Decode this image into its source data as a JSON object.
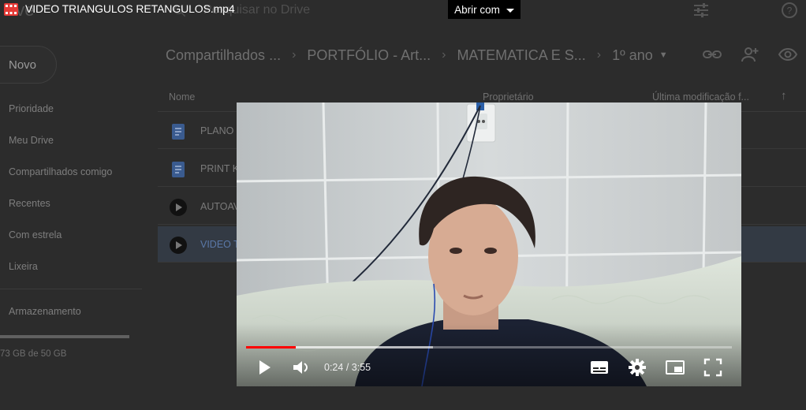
{
  "viewer": {
    "file_name": "VIDEO TRIANGULOS RETANGULOS.mp4",
    "open_with": "Abrir com",
    "file_type_icon": "video-file-icon",
    "file_type_color": "#e53935"
  },
  "drive": {
    "brand_partial": "rive",
    "search_placeholder": "Pesquisar no Drive",
    "new_button": "Novo",
    "sidebar": {
      "items": [
        {
          "label": "Prioridade",
          "icon": "priority-icon"
        },
        {
          "label": "Meu Drive",
          "icon": "drive-icon"
        },
        {
          "label": "Compartilhados comigo",
          "icon": "shared-icon"
        },
        {
          "label": "Recentes",
          "icon": "clock-icon"
        },
        {
          "label": "Com estrela",
          "icon": "star-icon"
        },
        {
          "label": "Lixeira",
          "icon": "trash-icon"
        }
      ],
      "storage_label": "Armazenamento",
      "storage_text": "73 GB de 50 GB"
    },
    "breadcrumb": [
      "Compartilhados ...",
      "PORTFÓLIO - Art...",
      "MATEMATICA E S...",
      "1º ano"
    ],
    "columns": {
      "name": "Nome",
      "owner": "Proprietário",
      "modified": "Última modificação f..."
    },
    "files": [
      {
        "name": "PLANO",
        "icon": "doc-icon",
        "selected": false
      },
      {
        "name": "PRINT K",
        "icon": "doc-icon",
        "selected": false
      },
      {
        "name": "AUTOAV",
        "icon": "video-thumb-icon",
        "selected": false
      },
      {
        "name": "VIDEO T",
        "icon": "video-thumb-icon",
        "selected": true
      }
    ]
  },
  "player": {
    "current_time": "0:24",
    "separator": " / ",
    "duration": "3:55",
    "played_fraction": 0.102,
    "buffered_fraction": 0.385,
    "accent": "#ff0000"
  }
}
